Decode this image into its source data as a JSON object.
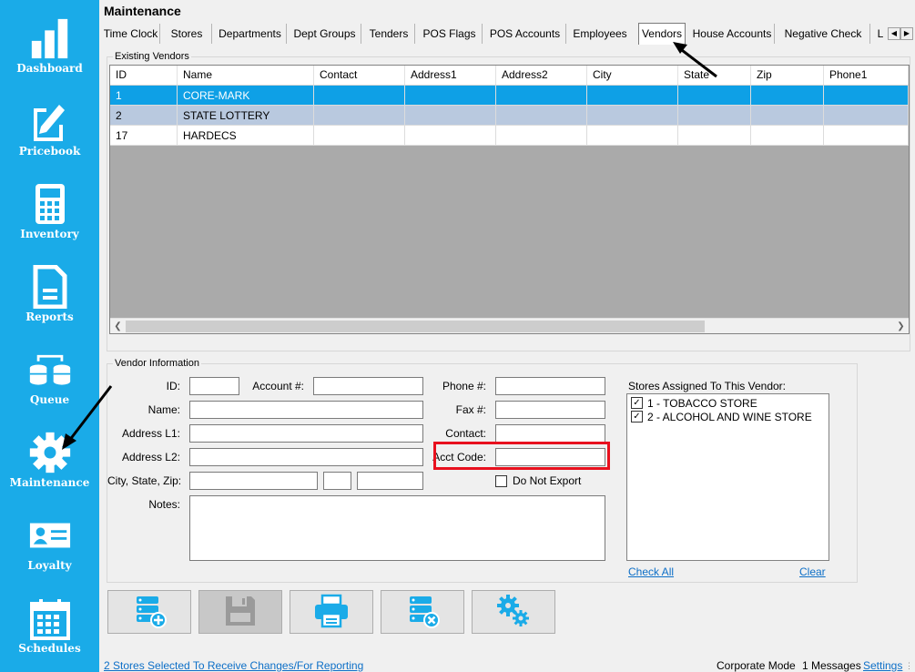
{
  "sidebar": {
    "items": [
      {
        "label": "Dashboard",
        "icon": "bar-chart-icon"
      },
      {
        "label": "Pricebook",
        "icon": "document-edit-icon"
      },
      {
        "label": "Inventory",
        "icon": "calculator-icon"
      },
      {
        "label": "Reports",
        "icon": "document-icon"
      },
      {
        "label": "Queue",
        "icon": "database-sync-icon"
      },
      {
        "label": "Maintenance",
        "icon": "gear-icon"
      },
      {
        "label": "Loyalty",
        "icon": "id-card-icon"
      },
      {
        "label": "Schedules",
        "icon": "calendar-icon"
      }
    ]
  },
  "page": {
    "title": "Maintenance"
  },
  "tabs": [
    "Time Clock",
    "Stores",
    "Departments",
    "Dept Groups",
    "Tenders",
    "POS Flags",
    "POS Accounts",
    "Employees",
    "Vendors",
    "House Accounts",
    "Negative Check",
    "L"
  ],
  "active_tab": "Vendors",
  "existing_vendors": {
    "legend": "Existing Vendors",
    "columns": [
      "ID",
      "Name",
      "Contact",
      "Address1",
      "Address2",
      "City",
      "State",
      "Zip",
      "Phone1"
    ],
    "rows": [
      {
        "id": "1",
        "name": "CORE-MARK"
      },
      {
        "id": "2",
        "name": "STATE LOTTERY"
      },
      {
        "id": "17",
        "name": "HARDECS"
      }
    ]
  },
  "vendor_info": {
    "legend": "Vendor Information",
    "labels": {
      "id": "ID:",
      "account": "Account #:",
      "name": "Name:",
      "addr1": "Address L1:",
      "addr2": "Address L2:",
      "city_state_zip": "City, State, Zip:",
      "notes": "Notes:",
      "phone": "Phone #:",
      "fax": "Fax #:",
      "contact": "Contact:",
      "acct_code": "Acct Code:",
      "do_not_export": "Do Not Export"
    },
    "stores_label": "Stores Assigned To This Vendor:",
    "stores": [
      {
        "label": "1 - TOBACCO STORE",
        "checked": true
      },
      {
        "label": "2 - ALCOHOL AND WINE STORE",
        "checked": true
      }
    ],
    "check_all": "Check All",
    "clear": "Clear"
  },
  "toolbar": [
    {
      "name": "add-vendor-button",
      "icon": "database-add-icon"
    },
    {
      "name": "save-button",
      "icon": "floppy-disk-icon",
      "disabled": true
    },
    {
      "name": "print-button",
      "icon": "printer-icon"
    },
    {
      "name": "delete-vendor-button",
      "icon": "database-delete-icon"
    },
    {
      "name": "settings-button",
      "icon": "gears-icon"
    }
  ],
  "status": {
    "stores_selected": "2 Stores Selected To Receive Changes/For Reporting",
    "mode": "Corporate Mode",
    "messages": "1 Messages",
    "settings": "Settings"
  },
  "colors": {
    "sidebar": "#1aabe8",
    "selected_row": "#0ea0e6",
    "highlight": "#e8101e"
  }
}
